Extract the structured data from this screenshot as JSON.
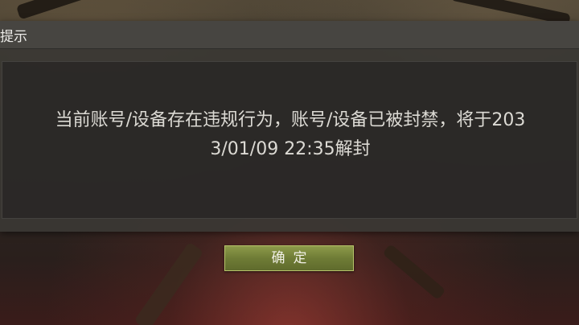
{
  "dialog": {
    "title": "提示",
    "message": "当前账号/设备存在违规行为，账号/设备已被封禁，将于203\n3/01/09 22:35解封"
  },
  "buttons": {
    "confirm_label": "确定"
  }
}
